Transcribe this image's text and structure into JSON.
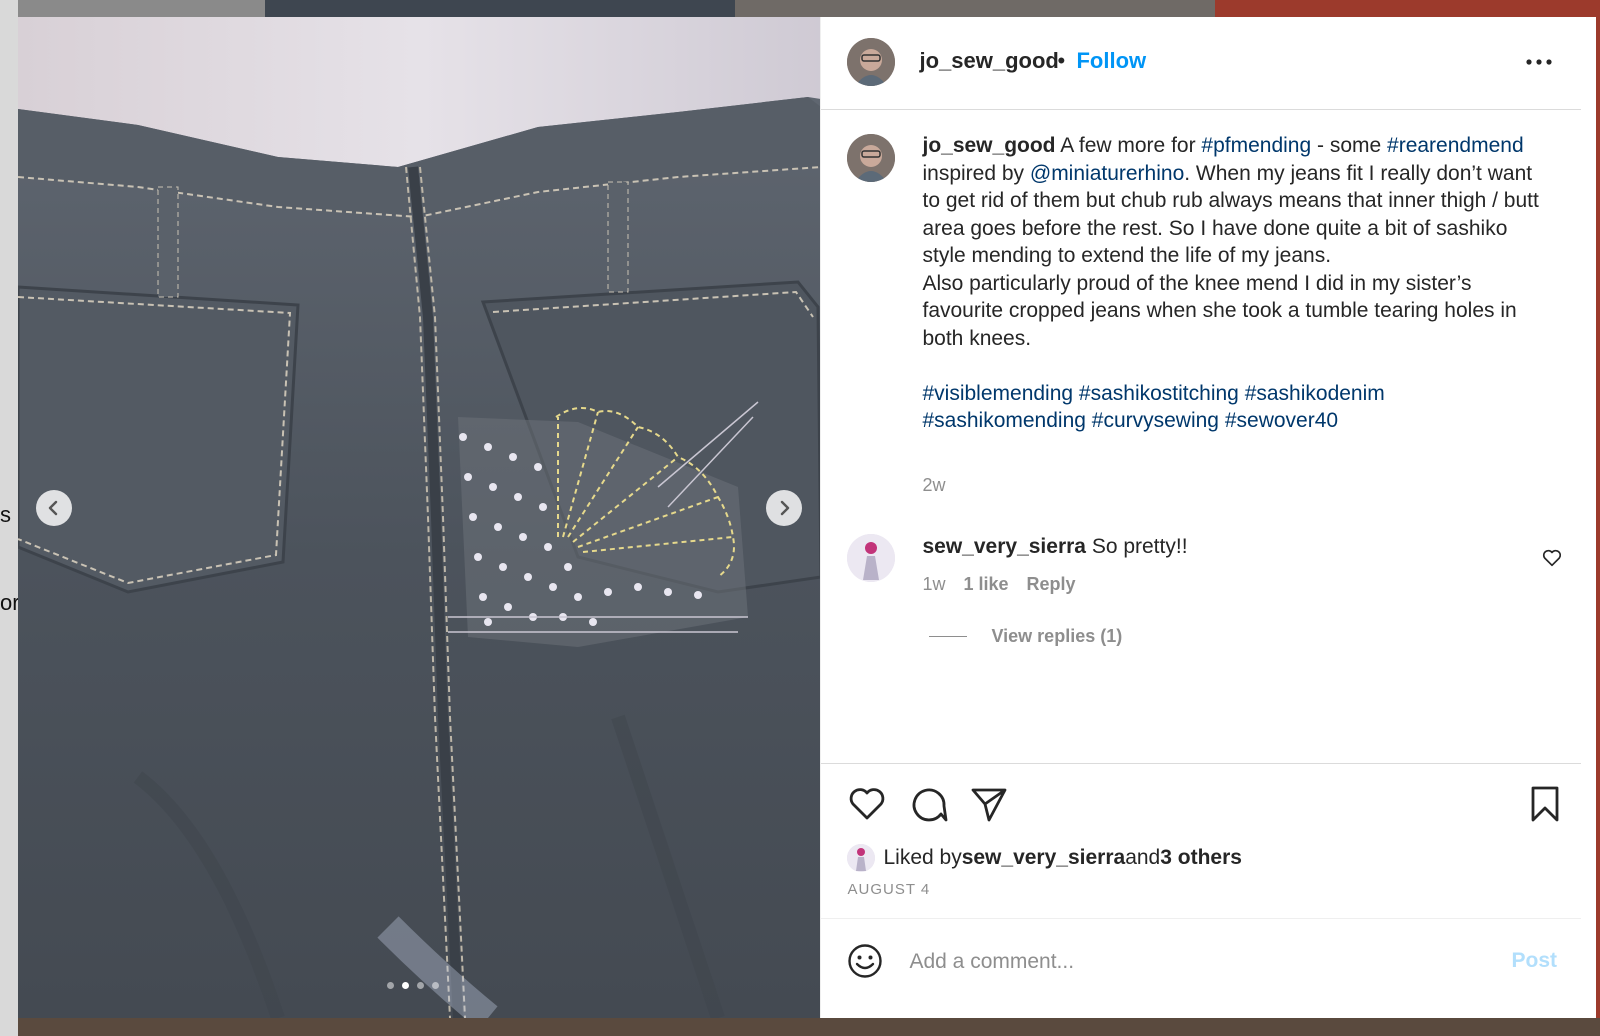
{
  "background": {
    "edge_letters": [
      "s",
      "or"
    ]
  },
  "media": {
    "prev_icon": "chevron-left-icon",
    "next_icon": "chevron-right-icon",
    "carousel_dots": 4,
    "active_dot": 1
  },
  "header": {
    "username": "jo_sew_good",
    "separator": "•",
    "follow_label": "Follow",
    "more_icon": "more-options-icon"
  },
  "caption": {
    "username": "jo_sew_good",
    "text_1": " A few more for ",
    "tag_pfmending": "#pfmending",
    "text_2": " - some ",
    "tag_rearendmend": "#rearendmend",
    "text_3": " inspired by ",
    "mention": "@miniaturerhino",
    "text_4": ". When my jeans fit I really don’t want to get rid of them but chub rub always means that inner thigh / butt area goes before the rest. So I have done quite a bit of sashiko style mending to extend the life of my jeans.",
    "text_5": "Also particularly proud of the knee mend I did in my sister’s favourite cropped jeans when she took a tumble tearing holes in both knees.",
    "hashtags": [
      "#visiblemending",
      "#sashikostitching",
      "#sashikodenim",
      "#sashikomending",
      "#curvysewing",
      "#sewover40"
    ],
    "time": "2w"
  },
  "comment": {
    "username": "sew_very_sierra",
    "text": "So pretty!!",
    "time": "1w",
    "likes": "1 like",
    "reply": "Reply",
    "view_replies": "View replies (1)"
  },
  "actions": {
    "like_icon": "heart-icon",
    "comment_icon": "comment-icon",
    "share_icon": "share-icon",
    "save_icon": "bookmark-icon",
    "liked_by_prefix": "Liked by ",
    "liked_by_user": "sew_very_sierra",
    "liked_by_and": " and ",
    "liked_by_others": "3 others",
    "date": "AUGUST 4"
  },
  "add_comment": {
    "placeholder": "Add a comment...",
    "post_label": "Post",
    "emoji_icon": "emoji-icon"
  },
  "colors": {
    "accent": "#0095f6",
    "hashtag": "#00376b",
    "muted": "#8e8e8e",
    "post_disabled": "#b2dffc"
  }
}
